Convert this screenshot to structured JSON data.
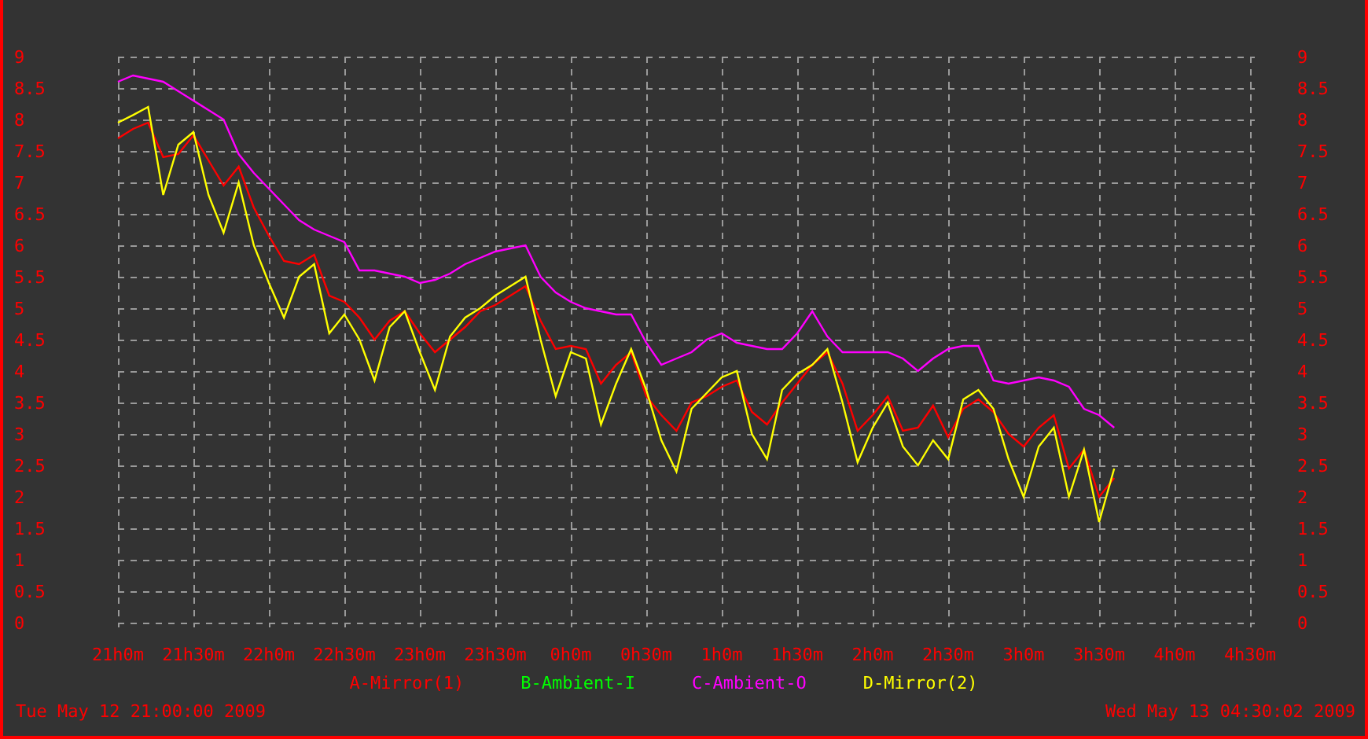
{
  "graph": {
    "chart_data": {
      "type": "line",
      "grid": true,
      "categories": [
        "21h0m",
        null,
        null,
        null,
        null,
        "21h30m",
        null,
        null,
        null,
        null,
        "22h0m",
        null,
        null,
        null,
        null,
        "22h30m",
        null,
        null,
        null,
        null,
        "23h0m",
        null,
        null,
        null,
        null,
        "23h30m",
        null,
        null,
        null,
        null,
        "0h0m",
        null,
        null,
        null,
        null,
        "0h30m",
        null,
        null,
        null,
        null,
        "1h0m",
        null,
        null,
        null,
        null,
        "1h30m",
        null,
        null,
        null,
        null,
        "2h0m",
        null,
        null,
        null,
        null,
        "2h30m",
        null,
        null,
        null,
        null,
        "3h0m",
        null,
        null,
        null,
        null,
        "3h30m",
        null,
        null,
        null,
        null,
        "4h0m",
        null,
        null,
        null,
        null,
        "4h30m"
      ],
      "series": [
        {
          "name": "A-Mirror(1)",
          "color": "#ff0000",
          "values": [
            7.7,
            7.85,
            7.95,
            7.4,
            7.45,
            7.75,
            7.35,
            6.95,
            7.25,
            6.6,
            6.15,
            5.75,
            5.7,
            5.85,
            5.2,
            5.1,
            4.85,
            4.5,
            4.8,
            4.95,
            4.6,
            4.3,
            4.5,
            4.7,
            4.95,
            5.05,
            5.2,
            5.35,
            4.8,
            4.35,
            4.4,
            4.35,
            3.8,
            4.1,
            4.3,
            3.6,
            3.3,
            3.05,
            3.5,
            3.6,
            3.75,
            3.85,
            3.35,
            3.15,
            3.5,
            3.8,
            4.1,
            4.3,
            3.8,
            3.05,
            3.3,
            3.6,
            3.05,
            3.1,
            3.45,
            2.95,
            3.4,
            3.55,
            3.35,
            3.0,
            2.8,
            3.1,
            3.3,
            2.45,
            2.75,
            2.0,
            2.3,
            null,
            null,
            null,
            null,
            null,
            null,
            null,
            null,
            null
          ]
        },
        {
          "name": "B-Ambient-I",
          "color": "#00ff00",
          "values": [
            null,
            null,
            null,
            null,
            null,
            null,
            null,
            null,
            null,
            null,
            null,
            null,
            null,
            null,
            null,
            null,
            null,
            null,
            null,
            null,
            null,
            null,
            null,
            null,
            null,
            null,
            null,
            null,
            null,
            null,
            null,
            null,
            null,
            null,
            null,
            null,
            null,
            null,
            null,
            null,
            null,
            null,
            null,
            null,
            null,
            null,
            null,
            null,
            null,
            null,
            null,
            null,
            null,
            null,
            null,
            null,
            null,
            null,
            null,
            null,
            null,
            null,
            null,
            null,
            null,
            null,
            null,
            null,
            null,
            null,
            null,
            null,
            null,
            null,
            null,
            null
          ]
        },
        {
          "name": "C-Ambient-O",
          "color": "#ff00ff",
          "values": [
            8.6,
            8.7,
            8.65,
            8.6,
            8.45,
            8.3,
            8.15,
            8.0,
            7.45,
            7.15,
            6.9,
            6.65,
            6.4,
            6.25,
            6.15,
            6.05,
            5.6,
            5.6,
            5.55,
            5.5,
            5.4,
            5.45,
            5.55,
            5.7,
            5.8,
            5.9,
            5.95,
            6.0,
            5.5,
            5.25,
            5.1,
            5.0,
            4.95,
            4.9,
            4.9,
            4.45,
            4.1,
            4.2,
            4.3,
            4.5,
            4.6,
            4.45,
            4.4,
            4.35,
            4.35,
            4.6,
            4.95,
            4.55,
            4.3,
            4.3,
            4.3,
            4.3,
            4.2,
            4.0,
            4.2,
            4.35,
            4.4,
            4.4,
            3.85,
            3.8,
            3.85,
            3.9,
            3.85,
            3.75,
            3.4,
            3.3,
            3.1,
            null,
            null,
            null,
            null,
            null,
            null,
            null,
            null,
            null
          ]
        },
        {
          "name": "D-Mirror(2)",
          "color": "#ffff00",
          "values": [
            7.95,
            8.07,
            8.2,
            6.8,
            7.6,
            7.8,
            6.8,
            6.2,
            7.0,
            6.0,
            5.4,
            4.85,
            5.5,
            5.7,
            4.6,
            4.9,
            4.5,
            3.85,
            4.7,
            4.95,
            4.3,
            3.7,
            4.55,
            4.85,
            5.0,
            5.2,
            5.35,
            5.5,
            4.5,
            3.6,
            4.3,
            4.2,
            3.15,
            3.8,
            4.35,
            3.7,
            2.9,
            2.4,
            3.4,
            3.65,
            3.9,
            4.0,
            3.0,
            2.6,
            3.7,
            3.95,
            4.1,
            4.35,
            3.5,
            2.55,
            3.1,
            3.5,
            2.8,
            2.5,
            2.9,
            2.6,
            3.55,
            3.7,
            3.4,
            2.6,
            2.0,
            2.8,
            3.1,
            2.0,
            2.75,
            1.6,
            2.45,
            null,
            null,
            null,
            null,
            null,
            null,
            null,
            null,
            null
          ]
        }
      ],
      "ylim": [
        0,
        9
      ],
      "yticks": [
        {
          "value": 9,
          "label": "9"
        },
        {
          "value": 8.5,
          "label": "8.5"
        },
        {
          "value": 8,
          "label": "8"
        },
        {
          "value": 7.5,
          "label": "7.5"
        },
        {
          "value": 7,
          "label": "7"
        },
        {
          "value": 6.5,
          "label": "6.5"
        },
        {
          "value": 6,
          "label": "6"
        },
        {
          "value": 5.5,
          "label": "5.5"
        },
        {
          "value": 5,
          "label": "5"
        },
        {
          "value": 4.5,
          "label": "4.5"
        },
        {
          "value": 4,
          "label": "4"
        },
        {
          "value": 3.5,
          "label": "3.5"
        },
        {
          "value": 3,
          "label": "3"
        },
        {
          "value": 2.5,
          "label": "2.5"
        },
        {
          "value": 2,
          "label": "2"
        },
        {
          "value": 1.5,
          "label": "1.5"
        },
        {
          "value": 1,
          "label": "1"
        },
        {
          "value": 0.5,
          "label": "0.5"
        },
        {
          "value": 0,
          "label": "0"
        }
      ]
    },
    "right_axis_labels": [
      "9",
      "8.5",
      "8",
      "7.5",
      "7",
      "6.5",
      "6",
      "5.5",
      "5",
      "4.5",
      "4",
      "3.5",
      "3",
      "2.5",
      "2",
      "1.5",
      "1",
      "0.5",
      "0"
    ]
  },
  "footer": {
    "start_time": "Tue May 12 21:00:00 2009",
    "end_time": "Wed May 13 04:30:02 2009"
  }
}
